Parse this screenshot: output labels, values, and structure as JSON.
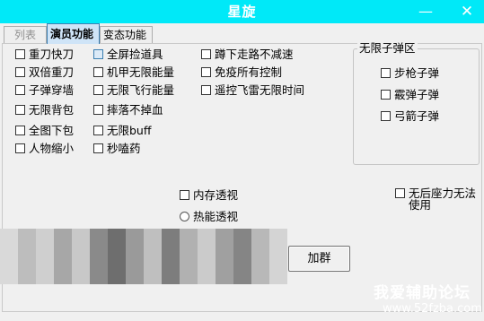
{
  "window": {
    "title": "星旋",
    "minimize_glyph": "—",
    "close_glyph": "✕"
  },
  "tabs": [
    {
      "label": "列表",
      "state": "disabled"
    },
    {
      "label": "演员功能",
      "state": "selected"
    },
    {
      "label": "变态功能",
      "state": "normal"
    }
  ],
  "options": {
    "col1": [
      "重刀快刀",
      "双倍重刀",
      "子弹穿墙",
      "无限背包",
      "全图下包",
      "人物缩小"
    ],
    "col2": [
      "全屏捡道具",
      "机甲无限能量",
      "无限飞行能量",
      "摔落不掉血",
      "无限buff",
      "秒嗑药"
    ],
    "col3": [
      "蹲下走路不减速",
      "免疫所有控制",
      "遥控飞雷无限时间"
    ],
    "col2_first_highlight": true
  },
  "ammo_group": {
    "title": "无限子弹区",
    "items": [
      "步枪子弹",
      "霰弹子弹",
      "弓箭子弹"
    ]
  },
  "memory_view": "内存透视",
  "thermal_view": "热能透视",
  "no_recoil": {
    "line1": "无后座力无法",
    "line2": "使用"
  },
  "join_group_button": "加群",
  "watermark": {
    "line1": "我爱辅助论坛",
    "line2": "www.52fzba.com"
  },
  "colors": {
    "titlebar": "#00e9f8",
    "tab_selected": "#cfe4f7",
    "window_bg": "#f0f0f0"
  },
  "icons": {
    "checkbox": "checkbox-icon",
    "radio": "radio-icon"
  }
}
